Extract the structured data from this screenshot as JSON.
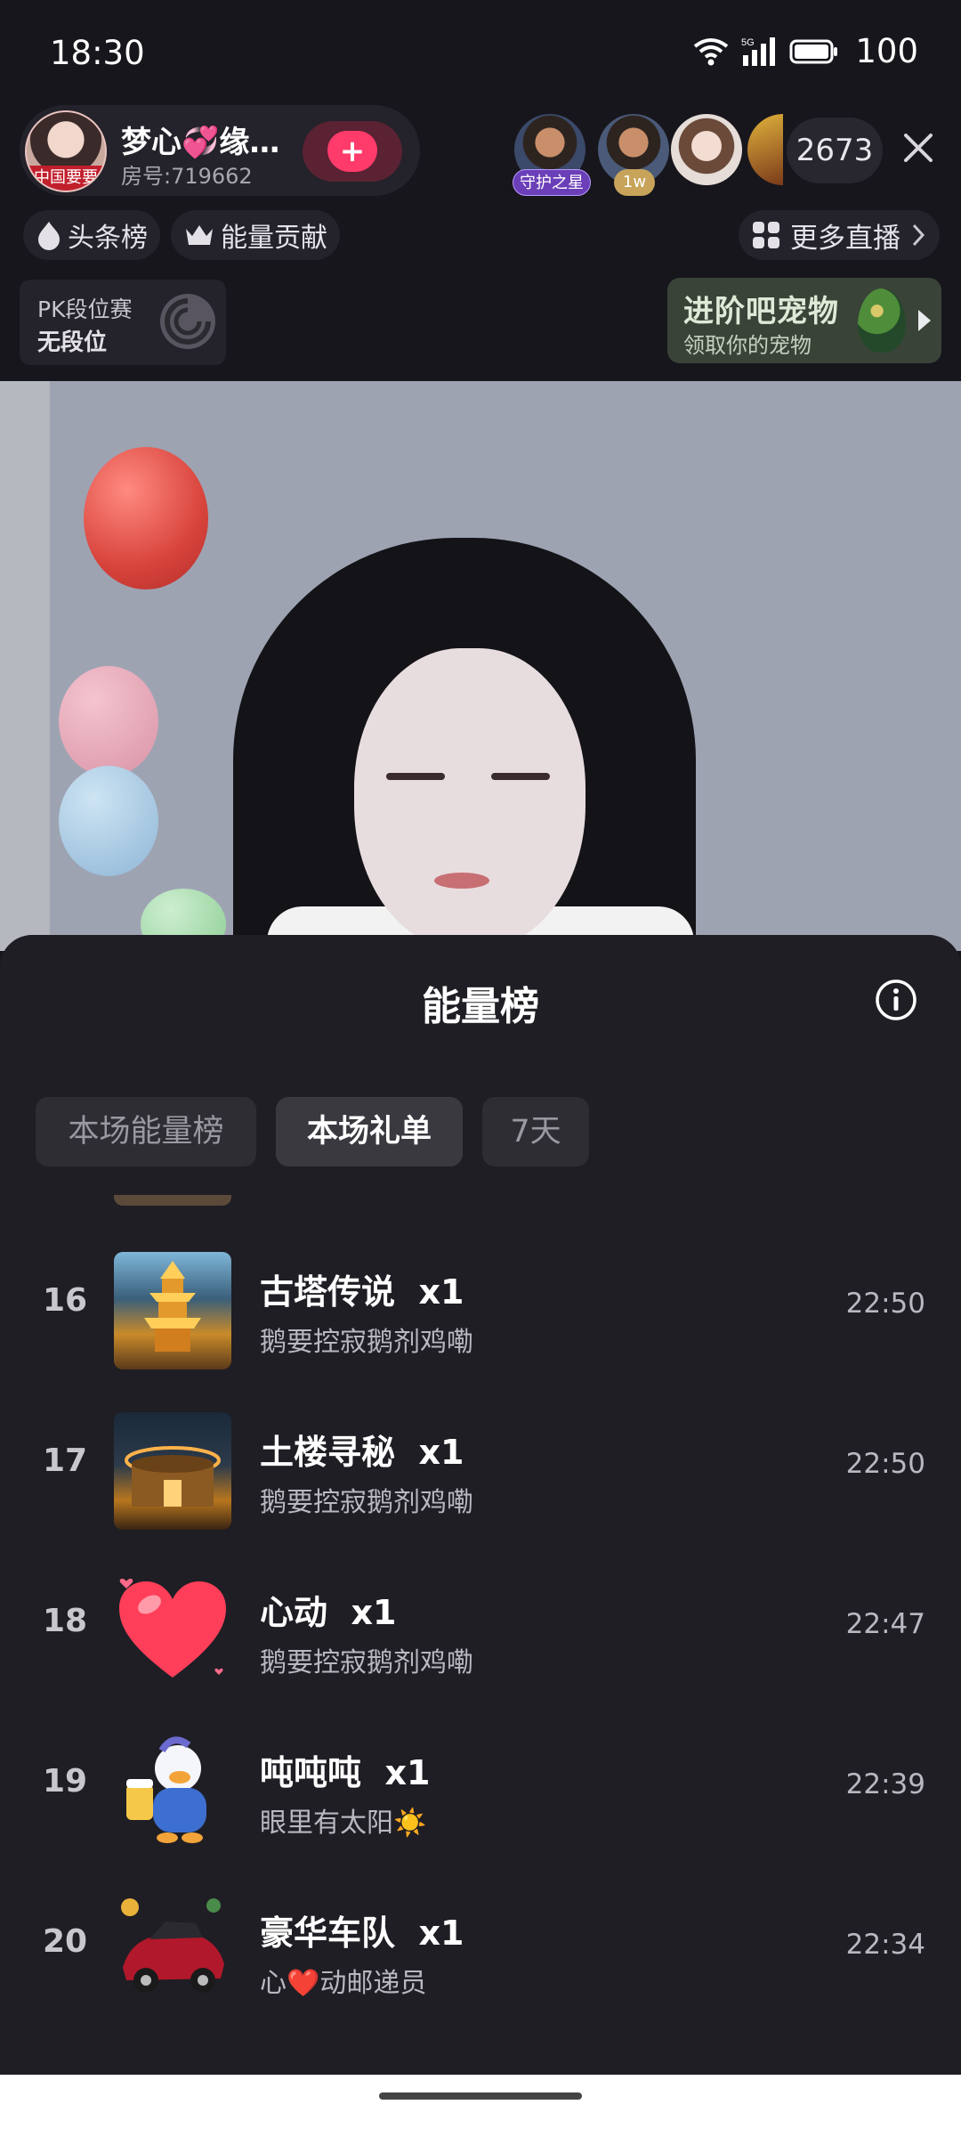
{
  "status": {
    "time": "18:30",
    "network": "5G",
    "battery": "100"
  },
  "room": {
    "host_name": "梦心💞缘…",
    "room_number": "房号:719662",
    "avatar_tag": "中国要要",
    "follow_symbol": "+",
    "viewer_badges": [
      "守护之星",
      "1w"
    ],
    "viewer_count": "2673"
  },
  "chips": {
    "headline_rank": "头条榜",
    "energy_contrib": "能量贡献",
    "more_live": "更多直播"
  },
  "pk": {
    "title": "PK段位赛",
    "rank": "无段位"
  },
  "pet_banner": {
    "title": "进阶吧宠物",
    "subtitle": "领取你的宠物"
  },
  "sheet": {
    "title": "能量榜",
    "tabs": [
      {
        "label": "本场能量榜",
        "active": false
      },
      {
        "label": "本场礼单",
        "active": true
      },
      {
        "label": "7天",
        "active": false
      }
    ],
    "rows": [
      {
        "rank": "16",
        "gift": "古塔传说",
        "count": "x1",
        "user": "鹅要控寂鹅剂鸡嘞",
        "time": "22:50",
        "icon": "pagoda-icon"
      },
      {
        "rank": "17",
        "gift": "土楼寻秘",
        "count": "x1",
        "user": "鹅要控寂鹅剂鸡嘞",
        "time": "22:50",
        "icon": "tulou-icon"
      },
      {
        "rank": "18",
        "gift": "心动",
        "count": "x1",
        "user": "鹅要控寂鹅剂鸡嘞",
        "time": "22:47",
        "icon": "heart-icon"
      },
      {
        "rank": "19",
        "gift": "吨吨吨",
        "count": "x1",
        "user": "眼里有太阳☀️",
        "time": "22:39",
        "icon": "duck-icon"
      },
      {
        "rank": "20",
        "gift": "豪华车队",
        "count": "x1",
        "user": "心❤️动邮递员",
        "time": "22:34",
        "icon": "car-icon"
      }
    ]
  },
  "colors": {
    "sheet_bg": "#1f1e24",
    "tab_active_bg": "#3a3940",
    "follow_pink": "#ff3b6b"
  }
}
